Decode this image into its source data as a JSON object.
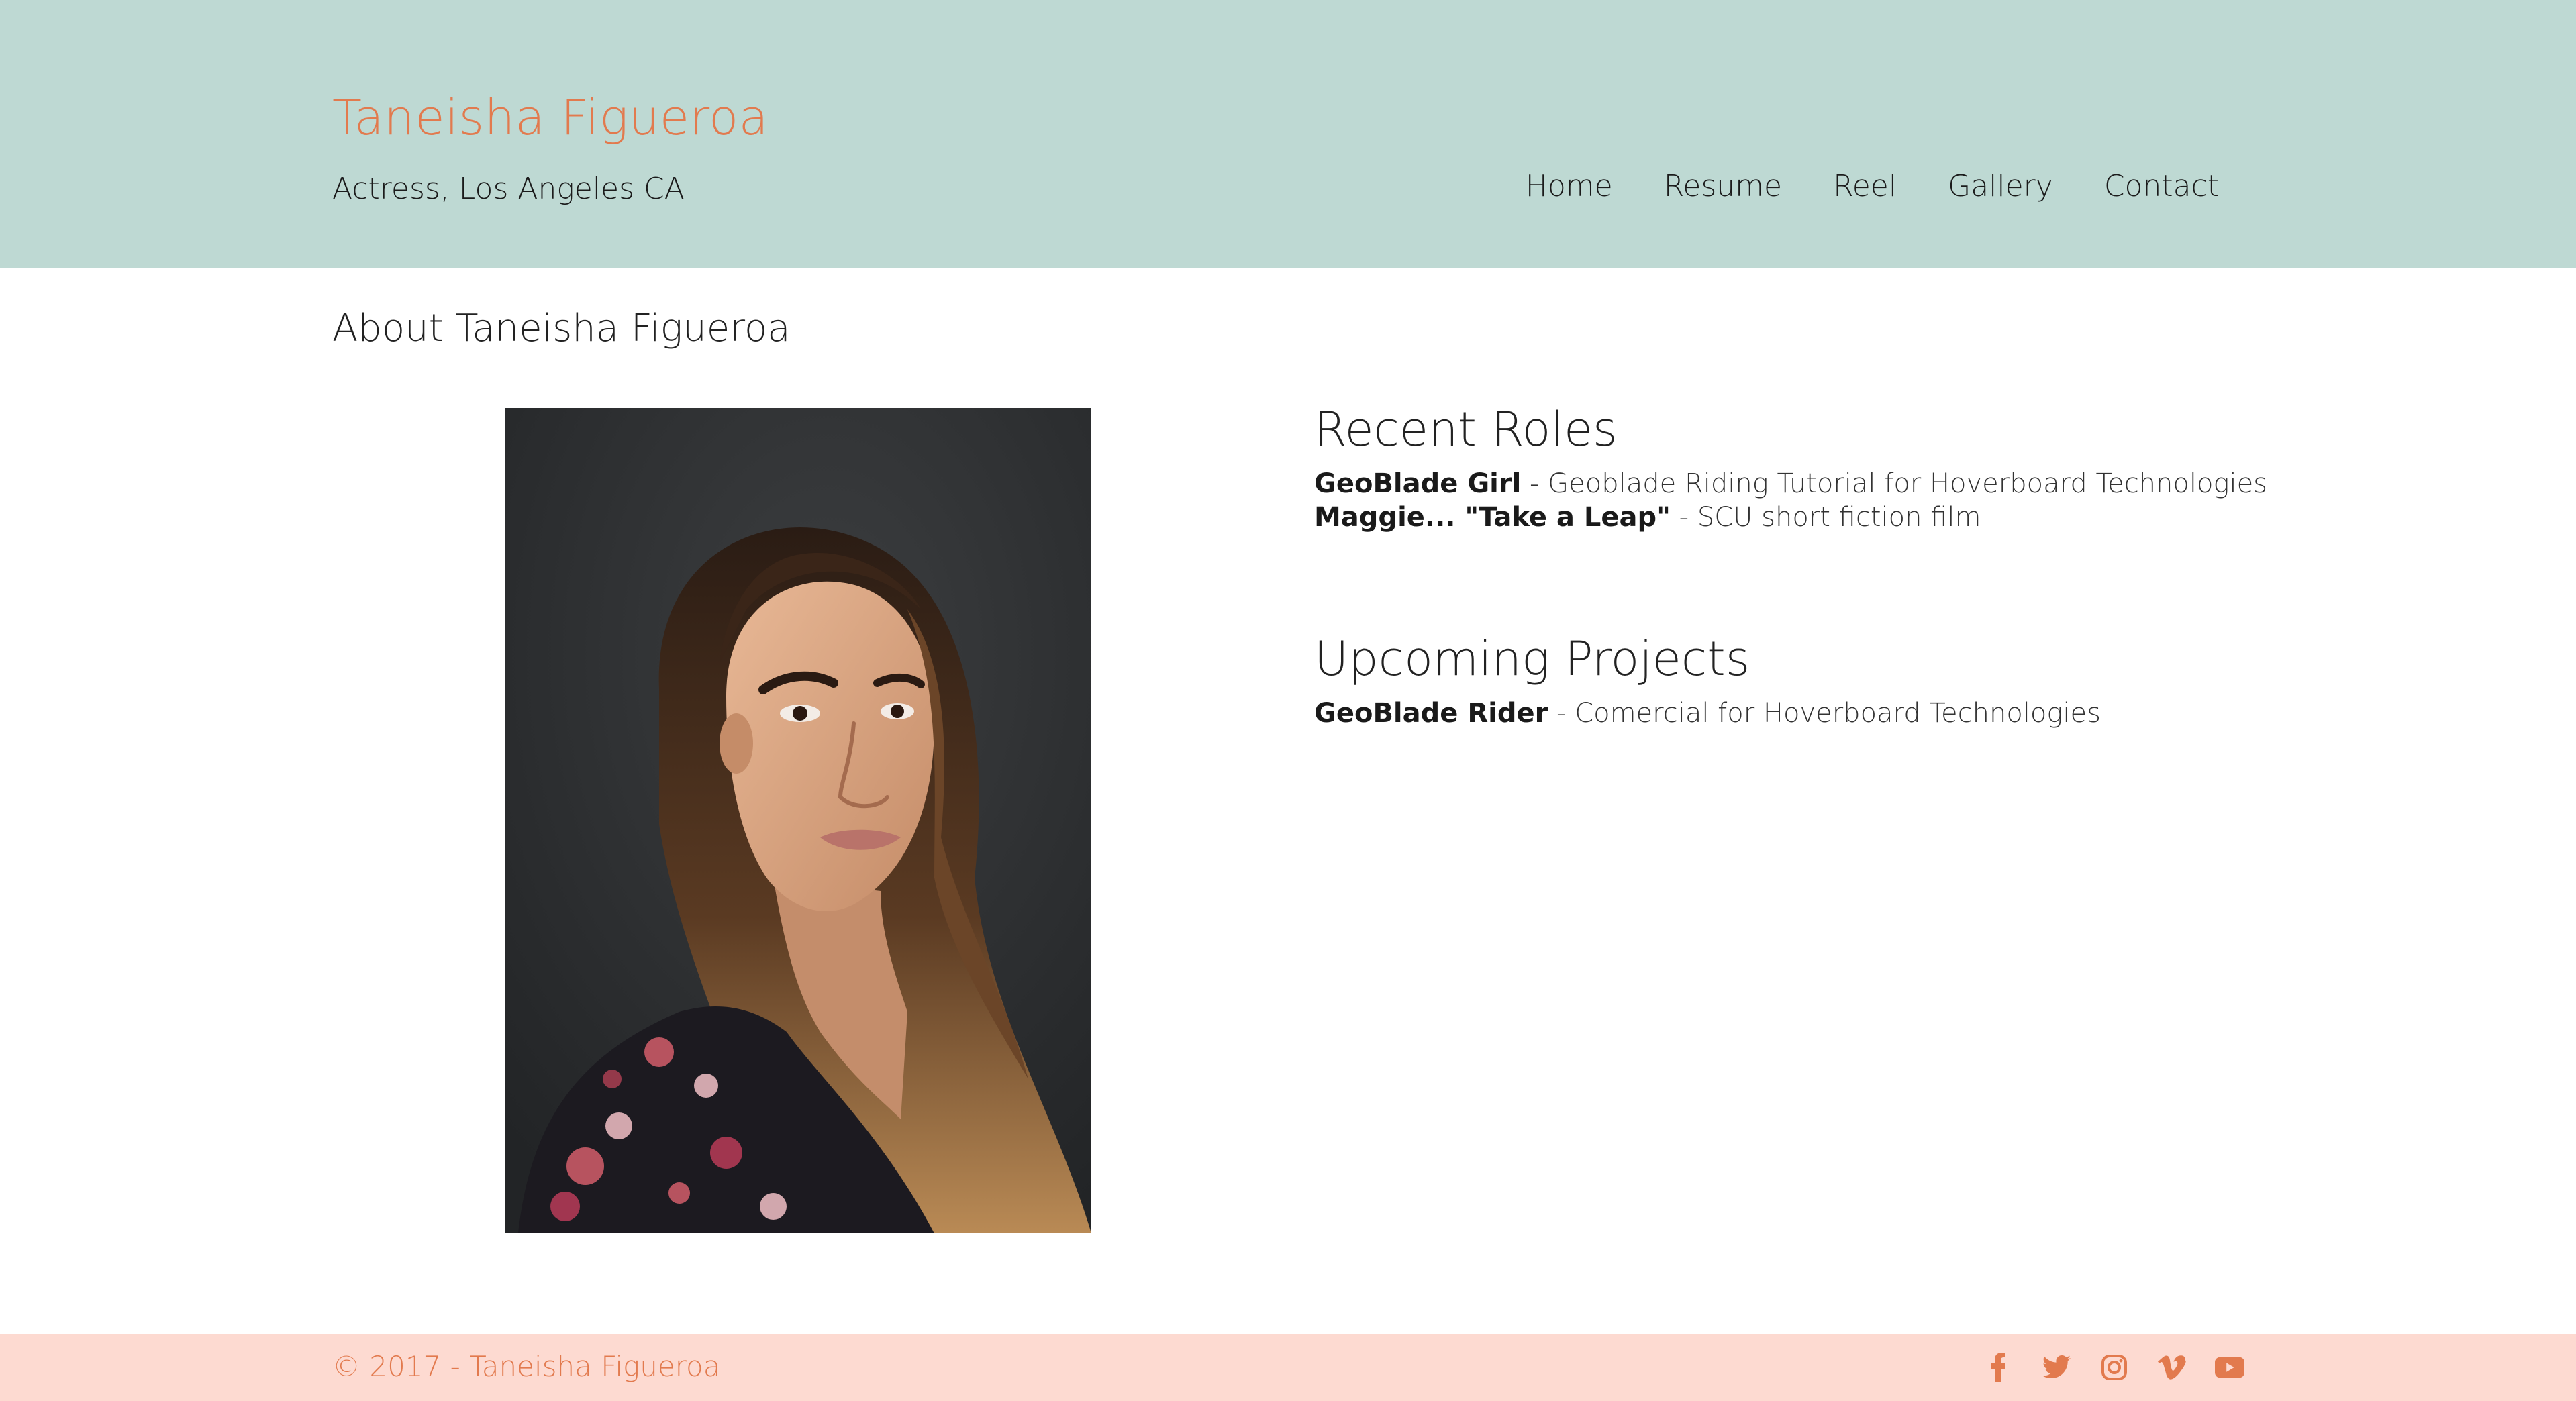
{
  "header": {
    "site_title": "Taneisha Figueroa",
    "tagline": "Actress, Los Angeles CA",
    "nav": [
      {
        "label": "Home"
      },
      {
        "label": "Resume"
      },
      {
        "label": "Reel"
      },
      {
        "label": "Gallery"
      },
      {
        "label": "Contact"
      }
    ]
  },
  "main": {
    "about_title": "About Taneisha Figueroa",
    "photo_icon": "headshot-photo",
    "recent_roles": {
      "heading": "Recent Roles",
      "items": [
        {
          "role": "GeoBlade Girl",
          "detail": " - Geoblade Riding Tutorial for Hoverboard Technologies"
        },
        {
          "role": "Maggie... \"Take a Leap\"",
          "detail": " - SCU short fiction film"
        }
      ]
    },
    "upcoming_projects": {
      "heading": "Upcoming Projects",
      "items": [
        {
          "role": "GeoBlade Rider",
          "detail": " - Comercial for Hoverboard Technologies"
        }
      ]
    }
  },
  "footer": {
    "copyright": "© 2017 - Taneisha Figueroa",
    "social_icons": [
      "facebook-icon",
      "twitter-icon",
      "instagram-icon",
      "vimeo-icon",
      "youtube-icon"
    ]
  },
  "colors": {
    "header_bg": "#bed9d3",
    "footer_bg": "#fddad1",
    "accent": "#e27a4e"
  }
}
